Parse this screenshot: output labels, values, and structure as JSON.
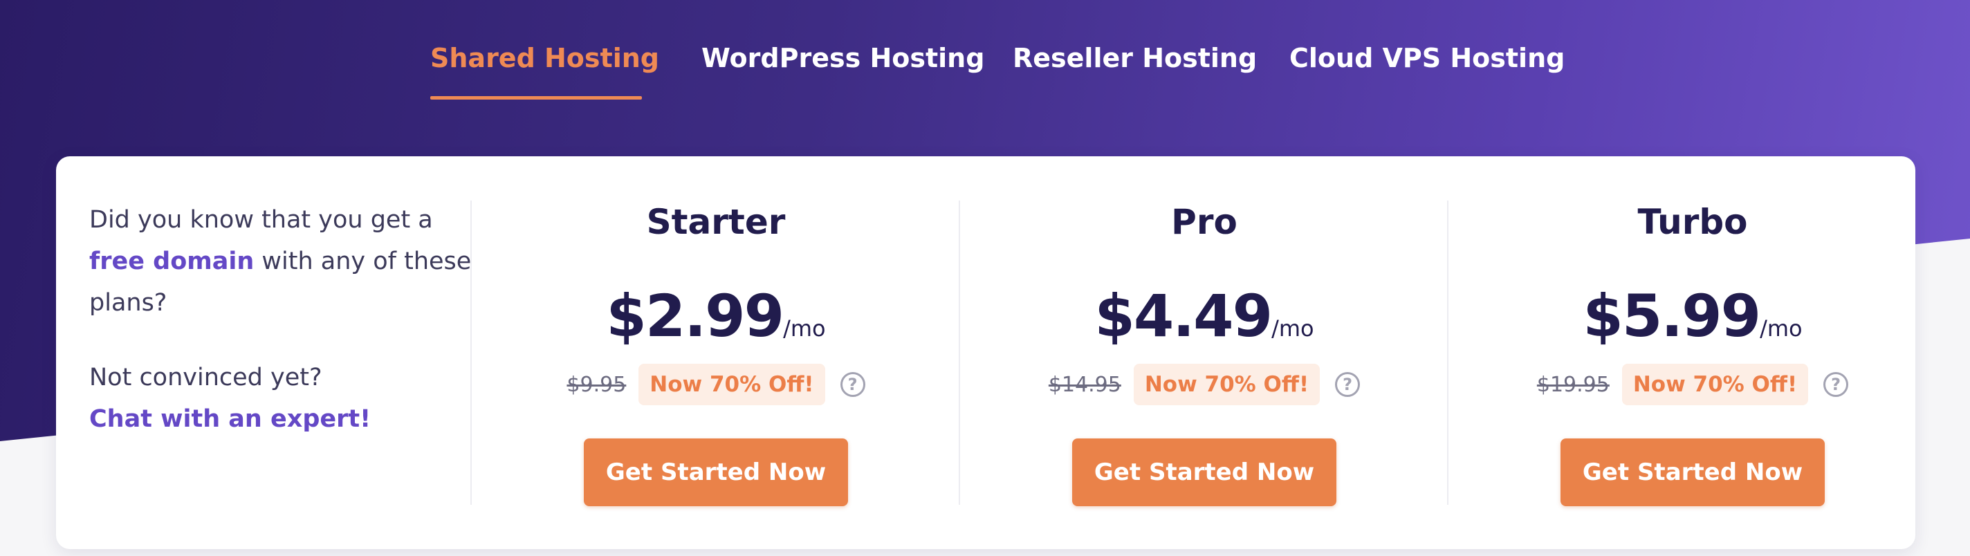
{
  "tabs": [
    {
      "label": "Shared Hosting",
      "active": true
    },
    {
      "label": "WordPress Hosting",
      "active": false
    },
    {
      "label": "Reseller Hosting",
      "active": false
    },
    {
      "label": "Cloud VPS Hosting",
      "active": false
    }
  ],
  "intro": {
    "line1_prefix": "Did you know that you get a",
    "line1_highlight": "free domain",
    "line1_suffix": "with any of these plans?",
    "line2": "Not convinced yet?",
    "chat_link": "Chat with an expert!"
  },
  "plans": [
    {
      "name": "Starter",
      "price": "$2.99",
      "per": "/mo",
      "old_price": "$9.95",
      "discount": "Now 70% Off!",
      "help_glyph": "?",
      "cta": "Get Started Now"
    },
    {
      "name": "Pro",
      "price": "$4.49",
      "per": "/mo",
      "old_price": "$14.95",
      "discount": "Now 70% Off!",
      "help_glyph": "?",
      "cta": "Get Started Now"
    },
    {
      "name": "Turbo",
      "price": "$5.99",
      "per": "/mo",
      "old_price": "$19.95",
      "discount": "Now 70% Off!",
      "help_glyph": "?",
      "cta": "Get Started Now"
    }
  ],
  "colors": {
    "accent": "#ea8249",
    "accent_text": "#ef8a54",
    "highlight": "#6448c6",
    "heading": "#211c4d",
    "gradient_start": "#2b1c66",
    "gradient_end": "#7155cc"
  },
  "icons": {
    "help": "question-circle-icon"
  }
}
